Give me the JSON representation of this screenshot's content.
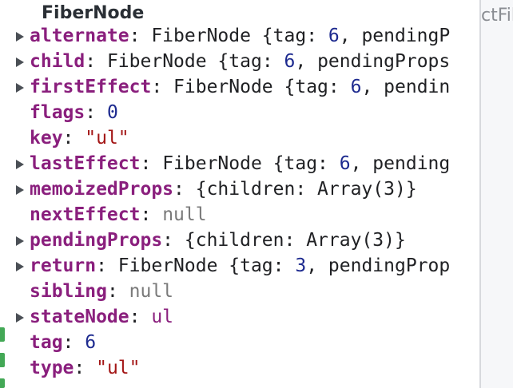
{
  "colors": {
    "key": "#8a1f7d",
    "number": "#1d2a8f",
    "string": "#a31515",
    "null": "#7a7a7a",
    "text": "#202124",
    "edge_green": "#2f9e44",
    "toggle": "#4a4f55"
  },
  "background_text": "ctFib",
  "tooltip": {
    "title": "FiberNode",
    "properties": [
      {
        "key": "alternate",
        "expandable": true,
        "parts": [
          {
            "t": "FiberNode {tag: ",
            "c": "val"
          },
          {
            "t": "6",
            "c": "num"
          },
          {
            "t": ", pendingP",
            "c": "val"
          }
        ]
      },
      {
        "key": "child",
        "expandable": true,
        "parts": [
          {
            "t": "FiberNode {tag: ",
            "c": "val"
          },
          {
            "t": "6",
            "c": "num"
          },
          {
            "t": ", pendingProps",
            "c": "val"
          }
        ]
      },
      {
        "key": "firstEffect",
        "expandable": true,
        "parts": [
          {
            "t": "FiberNode {tag: ",
            "c": "val"
          },
          {
            "t": "6",
            "c": "num"
          },
          {
            "t": ", pendin",
            "c": "val"
          }
        ]
      },
      {
        "key": "flags",
        "expandable": false,
        "parts": [
          {
            "t": "0",
            "c": "num"
          }
        ]
      },
      {
        "key": "key",
        "expandable": false,
        "parts": [
          {
            "t": "\"ul\"",
            "c": "str"
          }
        ]
      },
      {
        "key": "lastEffect",
        "expandable": true,
        "parts": [
          {
            "t": "FiberNode {tag: ",
            "c": "val"
          },
          {
            "t": "6",
            "c": "num"
          },
          {
            "t": ", pending",
            "c": "val"
          }
        ]
      },
      {
        "key": "memoizedProps",
        "expandable": true,
        "parts": [
          {
            "t": "{children: Array(3)}",
            "c": "val"
          }
        ]
      },
      {
        "key": "nextEffect",
        "expandable": false,
        "parts": [
          {
            "t": "null",
            "c": "nil"
          }
        ]
      },
      {
        "key": "pendingProps",
        "expandable": true,
        "parts": [
          {
            "t": "{children: Array(3)}",
            "c": "val"
          }
        ]
      },
      {
        "key": "return",
        "expandable": true,
        "parts": [
          {
            "t": "FiberNode {tag: ",
            "c": "val"
          },
          {
            "t": "3",
            "c": "num"
          },
          {
            "t": ", pendingProp",
            "c": "val"
          }
        ]
      },
      {
        "key": "sibling",
        "expandable": false,
        "parts": [
          {
            "t": "null",
            "c": "nil"
          }
        ]
      },
      {
        "key": "stateNode",
        "expandable": true,
        "parts": [
          {
            "t": "ul",
            "c": "dom"
          }
        ]
      },
      {
        "key": "tag",
        "expandable": false,
        "parts": [
          {
            "t": "6",
            "c": "num"
          }
        ]
      },
      {
        "key": "type",
        "expandable": false,
        "parts": [
          {
            "t": "\"ul\"",
            "c": "str"
          }
        ]
      }
    ]
  }
}
